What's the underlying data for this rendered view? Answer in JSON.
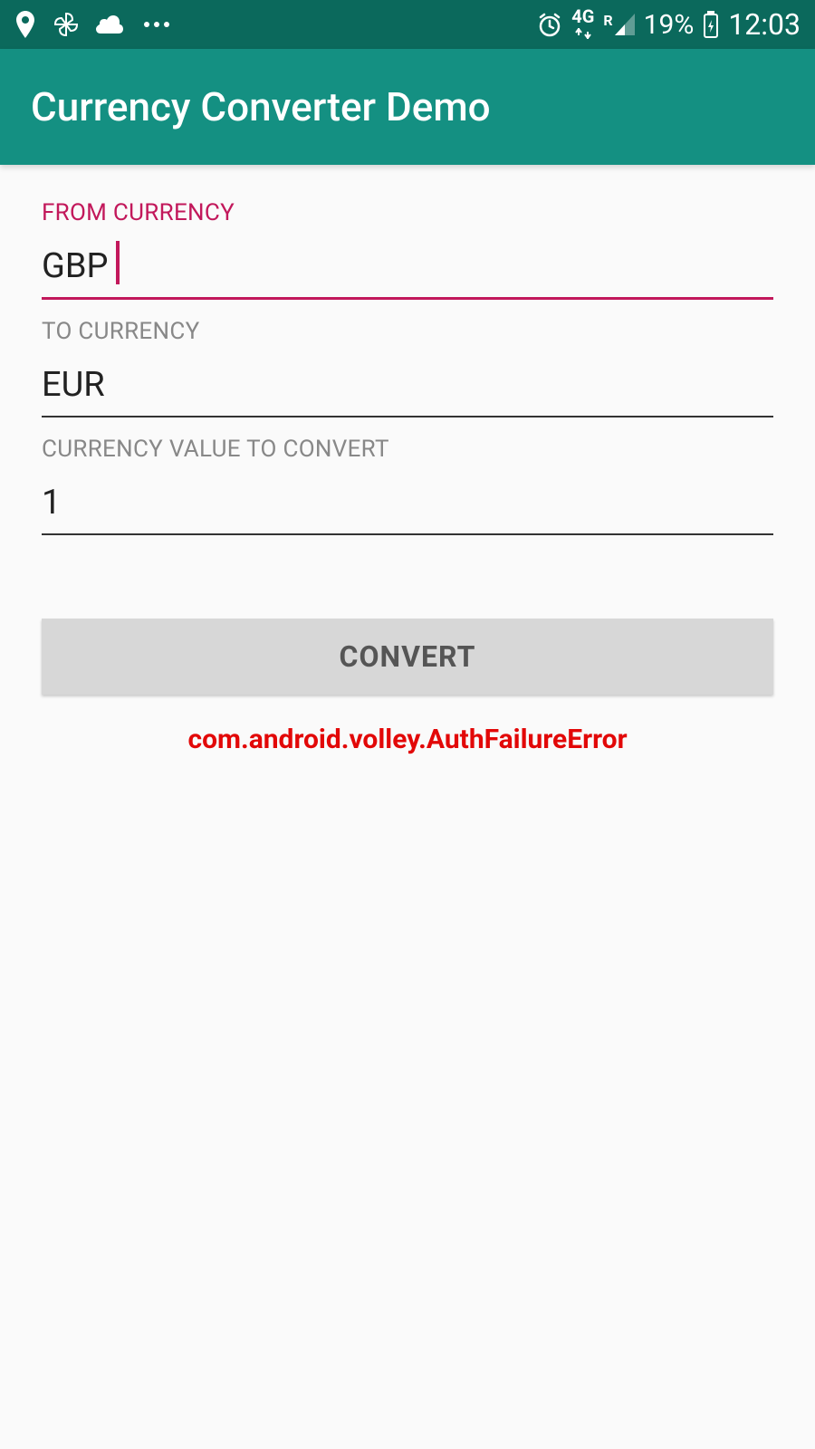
{
  "status_bar": {
    "battery_percent": "19%",
    "clock": "12:03",
    "network_type": "4G",
    "roaming_indicator": "R"
  },
  "app_bar": {
    "title": "Currency Converter Demo"
  },
  "form": {
    "from_label": "FROM CURRENCY",
    "from_value": "GBP",
    "to_label": "TO CURRENCY",
    "to_value": "EUR",
    "value_label": "CURRENCY VALUE TO CONVERT",
    "value_input": "1",
    "convert_button": "CONVERT"
  },
  "error": {
    "message": "com.android.volley.AuthFailureError"
  }
}
